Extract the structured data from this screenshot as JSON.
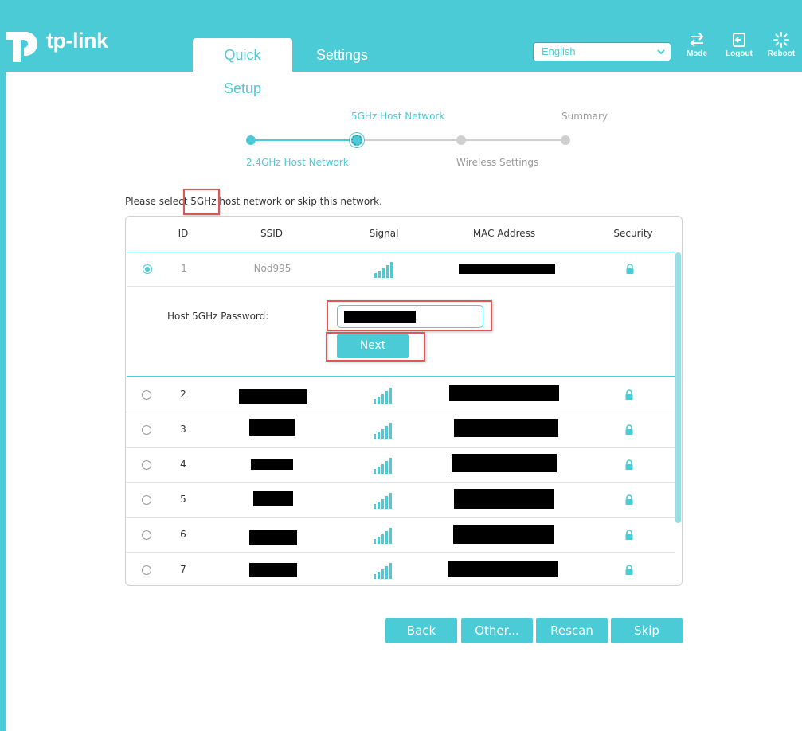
{
  "header": {
    "logo_text": "tp-link",
    "tabs": [
      {
        "label": "Quick Setup"
      },
      {
        "label": "Settings"
      }
    ],
    "language": "English",
    "buttons": [
      {
        "label": "Mode",
        "icon": "mode-icon"
      },
      {
        "label": "Logout",
        "icon": "logout-icon"
      },
      {
        "label": "Reboot",
        "icon": "reboot-icon"
      }
    ]
  },
  "stepper": {
    "steps": [
      {
        "label": "2.4GHz Host Network",
        "status": "done"
      },
      {
        "label": "5GHz Host Network",
        "status": "current"
      },
      {
        "label": "Wireless Settings",
        "status": "pending"
      },
      {
        "label": "Summary",
        "status": "pending"
      }
    ]
  },
  "prompt": {
    "before": "Please select ",
    "highlight": "5GHz",
    "after": " host network or skip this network."
  },
  "table": {
    "columns": [
      "ID",
      "SSID",
      "Signal",
      "MAC Address",
      "Security"
    ],
    "rows": [
      {
        "id": "1",
        "ssid": "Nod995",
        "selected": true
      },
      {
        "id": "2",
        "ssid": "",
        "selected": false
      },
      {
        "id": "3",
        "ssid": "",
        "selected": false
      },
      {
        "id": "4",
        "ssid": "",
        "selected": false
      },
      {
        "id": "5",
        "ssid": "",
        "selected": false
      },
      {
        "id": "6",
        "ssid": "",
        "selected": false
      },
      {
        "id": "7",
        "ssid": "",
        "selected": false
      }
    ],
    "password_label": "Host 5GHz Password:",
    "next_label": "Next"
  },
  "footer": {
    "back": "Back",
    "other": "Other...",
    "rescan": "Rescan",
    "skip": "Skip"
  },
  "colors": {
    "accent": "#4acbd6",
    "highlight": "#e05555"
  }
}
